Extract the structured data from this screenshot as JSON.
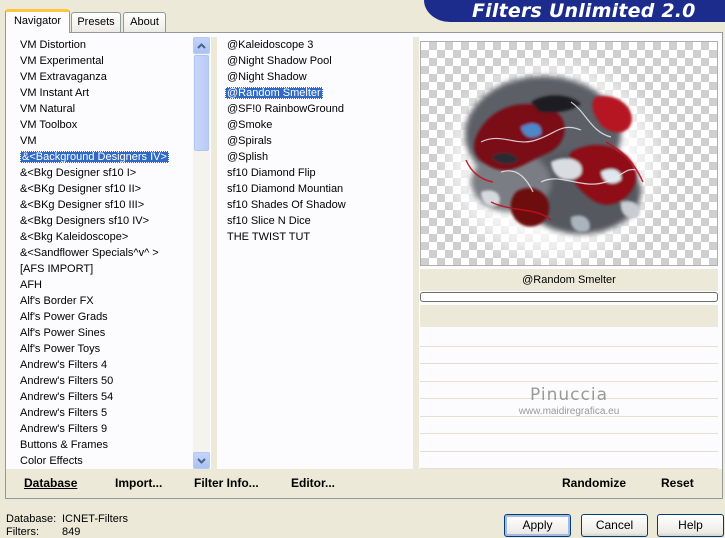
{
  "app_title": "Filters Unlimited 2.0",
  "tabs": [
    {
      "label": "Navigator"
    },
    {
      "label": "Presets"
    },
    {
      "label": "About"
    }
  ],
  "categories": {
    "items": [
      "VM Distortion",
      "VM Experimental",
      "VM Extravaganza",
      "VM Instant Art",
      "VM Natural",
      "VM Toolbox",
      "VM",
      "&<Background Designers IV>",
      "&<Bkg Designer sf10 I>",
      "&<BKg Designer sf10 II>",
      "&<BKg Designer sf10 III>",
      "&<Bkg Designers sf10 IV>",
      "&<Bkg Kaleidoscope>",
      "&<Sandflower Specials^v^ >",
      "[AFS IMPORT]",
      "AFH",
      "Alf's Border FX",
      "Alf's Power Grads",
      "Alf's Power Sines",
      "Alf's Power Toys",
      "Andrew's Filters 4",
      "Andrew's Filters 50",
      "Andrew's Filters 54",
      "Andrew's Filters 5",
      "Andrew's Filters 9",
      "Buttons & Frames",
      "Color Effects"
    ],
    "selected_index": 7
  },
  "filters": {
    "items": [
      "@Kaleidoscope 3",
      "@Night Shadow Pool",
      "@Night Shadow",
      "@Random Smelter",
      "@SF!0 RainbowGround",
      "@Smoke",
      "@Spirals",
      "@Splish",
      "sf10 Diamond Flip",
      "sf10 Diamond Mountian",
      "sf10 Shades Of Shadow",
      "sf10 Slice N Dice",
      "THE TWIST TUT"
    ],
    "selected_index": 3
  },
  "preview": {
    "filter_name": "@Random Smelter",
    "progress": 0
  },
  "watermark": {
    "line1": "Pinuccia",
    "line2": "www.maidiregrafica.eu"
  },
  "toolbar": {
    "database": "Database",
    "import": "Import...",
    "filter_info": "Filter Info...",
    "editor": "Editor...",
    "randomize": "Randomize",
    "reset": "Reset"
  },
  "status": {
    "database_label": "Database:",
    "database_value": "ICNET-Filters",
    "filters_label": "Filters:",
    "filters_value": "849"
  },
  "buttons": {
    "apply": "Apply",
    "cancel": "Cancel",
    "help": "Help"
  },
  "colors": {
    "banner": "#1c2c8c",
    "selection": "#316ac5",
    "active_tab_accent": "#ffc83c"
  }
}
